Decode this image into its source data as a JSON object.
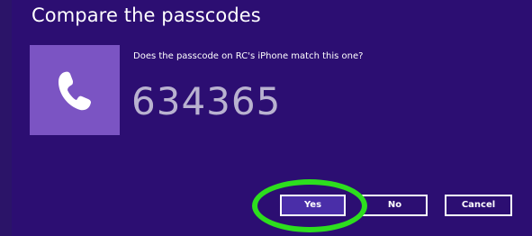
{
  "dialog": {
    "title": "Compare the passcodes",
    "question": "Does the passcode on RC's iPhone match this one?",
    "passcode": "634365",
    "icon": "phone-icon"
  },
  "buttons": {
    "yes_label": "Yes",
    "no_label": "No",
    "cancel_label": "Cancel"
  },
  "colors": {
    "background": "#2c0e72",
    "icon_tile": "#7b54c3",
    "passcode_text": "#b9b2d0",
    "highlight_ring": "#2dde1e"
  }
}
